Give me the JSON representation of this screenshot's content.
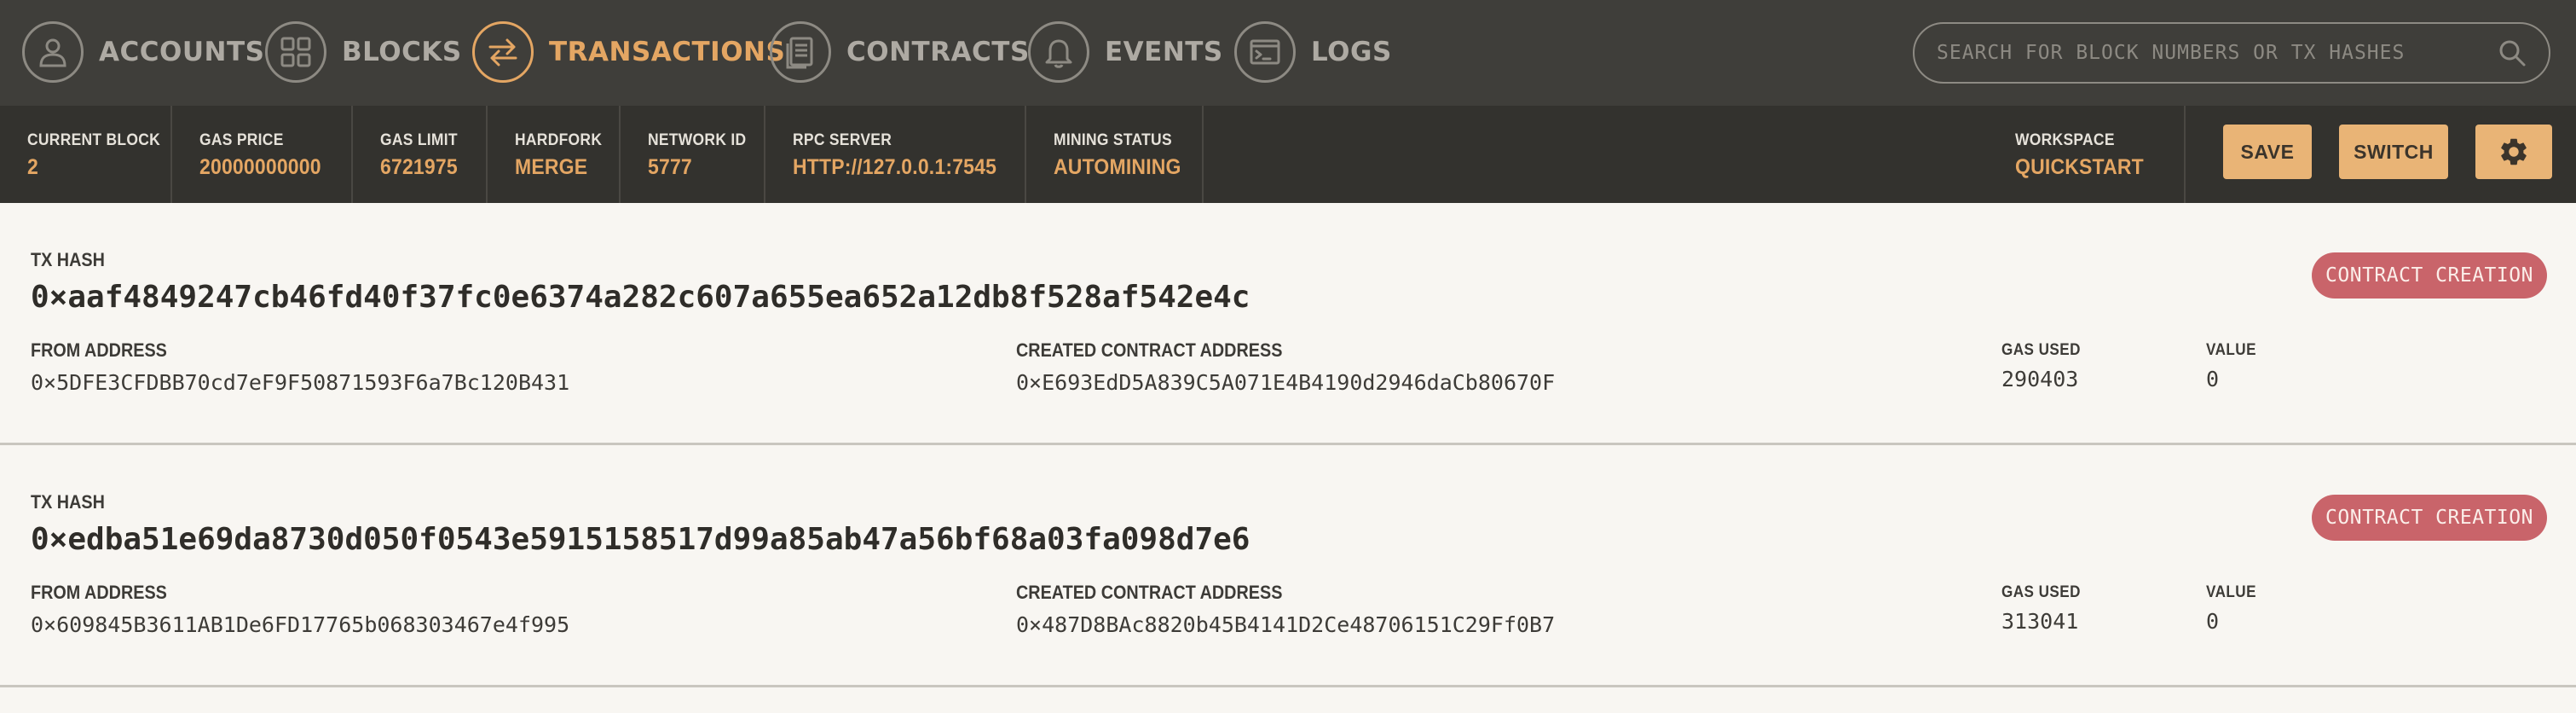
{
  "nav": {
    "items": [
      {
        "label": "ACCOUNTS",
        "icon": "account-icon"
      },
      {
        "label": "BLOCKS",
        "icon": "blocks-icon"
      },
      {
        "label": "TRANSACTIONS",
        "icon": "transactions-icon",
        "active": true
      },
      {
        "label": "CONTRACTS",
        "icon": "contracts-icon"
      },
      {
        "label": "EVENTS",
        "icon": "bell-icon"
      },
      {
        "label": "LOGS",
        "icon": "terminal-icon"
      }
    ],
    "search": {
      "placeholder": "SEARCH FOR BLOCK NUMBERS OR TX HASHES",
      "value": ""
    }
  },
  "status": {
    "current_block": {
      "label": "CURRENT BLOCK",
      "value": "2"
    },
    "gas_price": {
      "label": "GAS PRICE",
      "value": "20000000000"
    },
    "gas_limit": {
      "label": "GAS LIMIT",
      "value": "6721975"
    },
    "hardfork": {
      "label": "HARDFORK",
      "value": "MERGE"
    },
    "network_id": {
      "label": "NETWORK ID",
      "value": "5777"
    },
    "rpc_server": {
      "label": "RPC SERVER",
      "value": "HTTP://127.0.0.1:7545"
    },
    "mining_status": {
      "label": "MINING STATUS",
      "value": "AUTOMINING"
    },
    "workspace": {
      "label": "WORKSPACE",
      "value": "QUICKSTART"
    }
  },
  "toolbar": {
    "save_label": "SAVE",
    "switch_label": "SWITCH",
    "settings_icon": "gear-icon"
  },
  "transactions": [
    {
      "hash_label": "TX HASH",
      "hash": "0×aaf4849247cb46fd40f37fc0e6374a282c607a655ea652a12db8f528af542e4c",
      "from_label": "FROM ADDRESS",
      "from": "0×5DFE3CFDBB70cd7eF9F50871593F6a7Bc120B431",
      "contract_label": "CREATED CONTRACT ADDRESS",
      "contract": "0×E693EdD5A839C5A071E4B4190d2946daCb80670F",
      "gas_used_label": "GAS USED",
      "gas_used": "290403",
      "value_label": "VALUE",
      "value": "0",
      "badge": "CONTRACT CREATION"
    },
    {
      "hash_label": "TX HASH",
      "hash": "0×edba51e69da8730d050f0543e5915158517d99a85ab47a56bf68a03fa098d7e6",
      "from_label": "FROM ADDRESS",
      "from": "0×609845B3611AB1De6FD17765b068303467e4f995",
      "contract_label": "CREATED CONTRACT ADDRESS",
      "contract": "0×487D8BAc8820b45B4141D2Ce48706151C29Ff0B7",
      "gas_used_label": "GAS USED",
      "gas_used": "313041",
      "value_label": "VALUE",
      "value": "0",
      "badge": "CONTRACT CREATION"
    }
  ]
}
